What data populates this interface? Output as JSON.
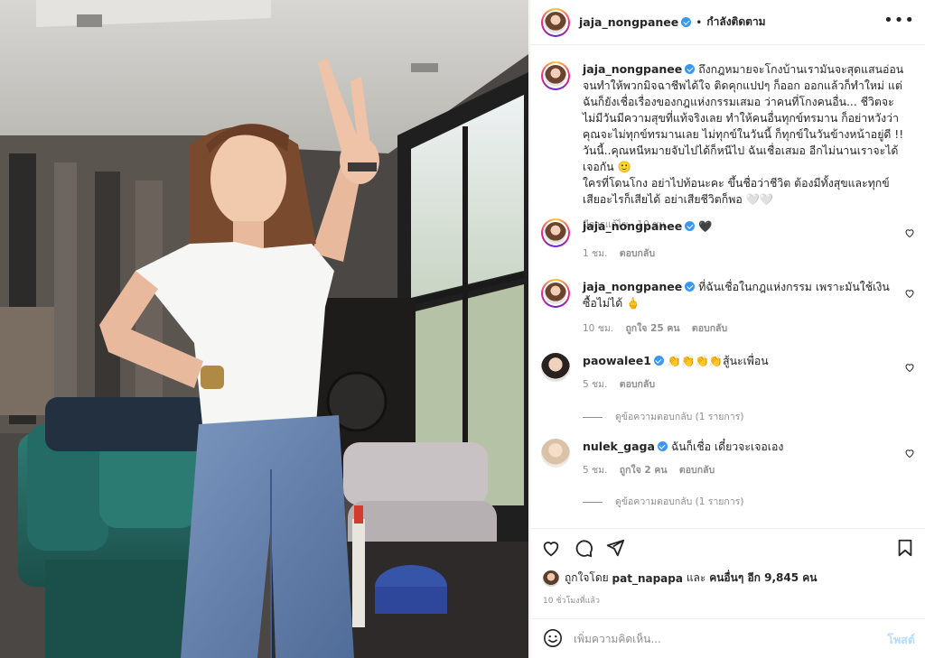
{
  "post": {
    "username": "jaja_nongpanee",
    "follow_label": "กำลังติดตาม",
    "more_icon": "more-horizontal-icon",
    "caption": {
      "text": "ถึงกฎหมายจะโกงบ้านเรามันจะสุดแสนอ่อน จนทำให้พวกมิจฉาชีพได้ใจ ติดคุกแปปๆ ก็ออก ออกแล้วก็ทำใหม่ แต่ฉันก็ยังเชื่อเรื่องของกฎแห่งกรรมเสมอ ว่าคนที่โกงคนอื่น... ชีวิตจะไม่มีวันมีความสุขที่แท้จริงเลย ทำให้คนอื่นทุกข์ทรมาน ก็อย่าหวังว่าคุณจะไม่ทุกข์ทรมานเลย ไม่ทุกข์ในวันนี้ ก็ทุกข์ในวันข้างหน้าอยู่ดี !! วันนี้..คุณหนีหมายจับไปได้ก็หนีไป ฉันเชื่อเสมอ อีกไม่นานเราจะได้เจอกัน 🙂",
      "text2": "ใครที่โดนโกง อย่าไปท้อนะคะ ขึ้นชื่อว่าชีวิต ต้องมีทั้งสุขและทุกข์ เสียอะไรก็เสียได้ อย่าเสียชีวิตก็พอ 🤍🤍",
      "edited_time": "มีการแก้ไข · 10 ชม."
    }
  },
  "comments": [
    {
      "username": "jaja_nongpanee",
      "text": "🖤",
      "time": "1 ชม.",
      "likes": "",
      "reply_label": "ตอบกลับ",
      "view_replies": ""
    },
    {
      "username": "jaja_nongpanee",
      "text": "ที่ฉันเชื่อในกฎแห่งกรรม เพราะมันใช้เงินซื้อไม่ได้ 🖕",
      "time": "10 ชม.",
      "likes": "ถูกใจ 25 คน",
      "reply_label": "ตอบกลับ",
      "view_replies": ""
    },
    {
      "username": "paowalee1",
      "text": "👏👏👏👏สู้นะเพื่อน",
      "time": "5 ชม.",
      "likes": "",
      "reply_label": "ตอบกลับ",
      "view_replies": "ดูข้อความตอบกลับ (1 รายการ)"
    },
    {
      "username": "nulek_gaga",
      "text": "ฉันก็เชื่อ เดี๋ยวจะเจอเอง",
      "time": "5 ชม.",
      "likes": "ถูกใจ 2 คน",
      "reply_label": "ตอบกลับ",
      "view_replies": "ดูข้อความตอบกลับ (1 รายการ)"
    }
  ],
  "actions": {
    "like_icon": "heart-icon",
    "comment_icon": "comment-icon",
    "share_icon": "send-icon",
    "save_icon": "bookmark-icon"
  },
  "likes": {
    "prefix": "ถูกใจโดย",
    "liker": "pat_napapa",
    "joiner": "และ",
    "others": "คนอื่นๆ อีก 9,845 คน"
  },
  "time_ago": "10 ชั่วโมงที่แล้ว",
  "add_comment": {
    "placeholder": "เพิ่มความคิดเห็น...",
    "post_label": "โพสต์"
  },
  "colors": {
    "verified": "#3897f0",
    "post_button_disabled": "#b3dbff",
    "secondary_text": "#8e8e8e"
  }
}
